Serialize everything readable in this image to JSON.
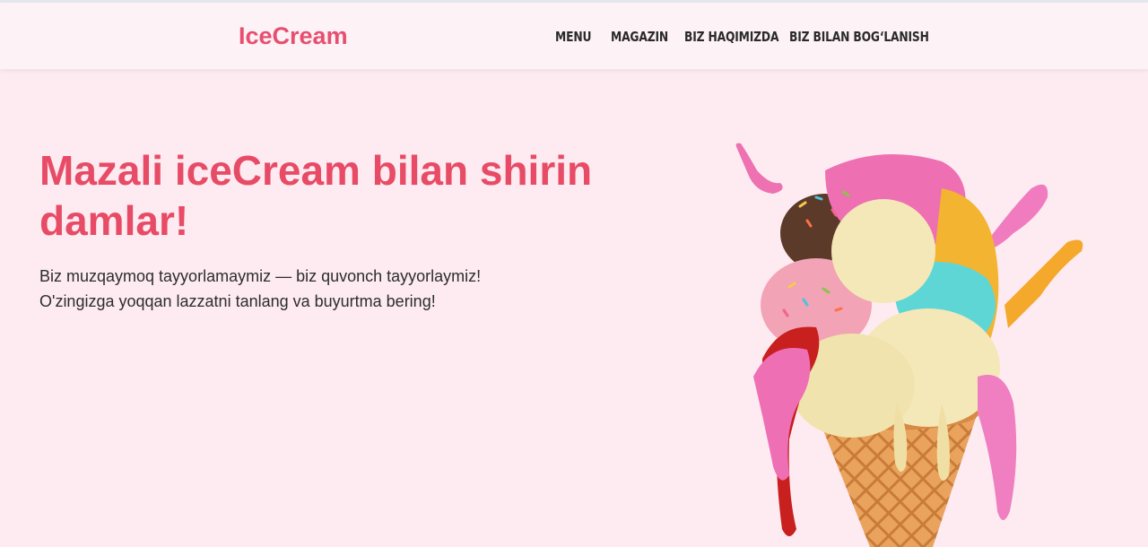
{
  "header": {
    "logo": "IceCream",
    "nav": [
      "MENU",
      "MAGAZIN",
      "BIZ HAQIMIZDA",
      "BIZ BILAN BOG‘LANISH"
    ]
  },
  "hero": {
    "title": "Mazali iceCream bilan shirin damlar!",
    "line1": "Biz muzqaymoq tayyorlamaymiz — biz quvonch tayyorlaymiz!",
    "line2": "O'zingizga yoqqan lazzatni tanlang va buyurtma bering!",
    "image": "ice-cream-cone-illustration"
  },
  "colors": {
    "page_background": "#fdebf1",
    "header_background": "#fdf2f6",
    "accent": "#e84b66",
    "nav_text": "#2a2a2a"
  }
}
